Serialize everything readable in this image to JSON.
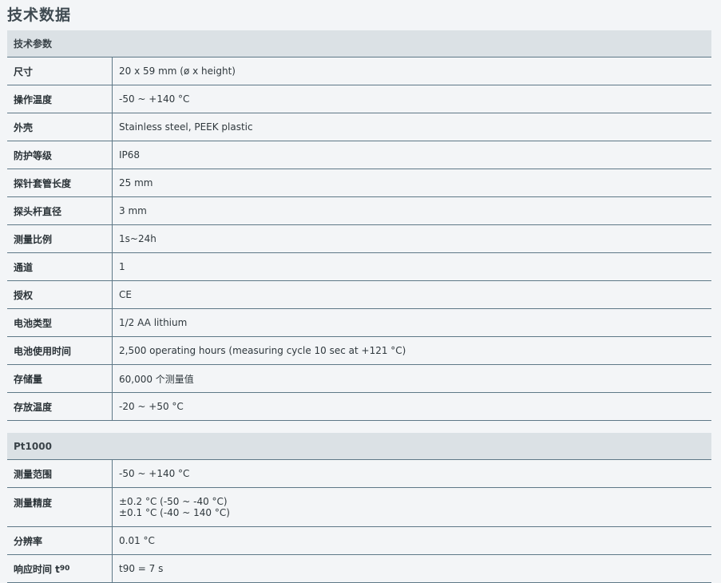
{
  "page": {
    "title": "技术数据"
  },
  "sections": [
    {
      "header": "技术参数",
      "rows": [
        {
          "label": "尺寸",
          "value": "20 x 59 mm (ø x height)"
        },
        {
          "label": "操作温度",
          "value": "-50 ~ +140 °C"
        },
        {
          "label": "外壳",
          "value": "Stainless steel, PEEK plastic"
        },
        {
          "label": "防护等级",
          "value": "IP68"
        },
        {
          "label": "探针套管长度",
          "value": "25 mm"
        },
        {
          "label": "探头杆直径",
          "value": "3 mm"
        },
        {
          "label": "测量比例",
          "value": "1s~24h"
        },
        {
          "label": "通道",
          "value": "1"
        },
        {
          "label": "授权",
          "value": "CE"
        },
        {
          "label": "电池类型",
          "value": "1/2 AA lithium"
        },
        {
          "label": "电池使用时间",
          "value": "2,500 operating hours (measuring cycle 10 sec at +121 °C)"
        },
        {
          "label": "存储量",
          "value": "60,000 个测量值"
        },
        {
          "label": "存放温度",
          "value": "-20 ~ +50 °C"
        }
      ]
    },
    {
      "header": "Pt1000",
      "rows": [
        {
          "label": "测量范围",
          "value": "-50 ~ +140 °C"
        },
        {
          "label": "测量精度",
          "value_line1": "±0.2 °C (-50 ~ -40 °C)",
          "value_line2": "±0.1 °C (-40 ~ 140 °C)"
        },
        {
          "label": "分辨率",
          "value": "0.01 °C"
        },
        {
          "label": "响应时间 t",
          "label_sub": "90",
          "value": "t90 = 7 s"
        }
      ]
    }
  ]
}
